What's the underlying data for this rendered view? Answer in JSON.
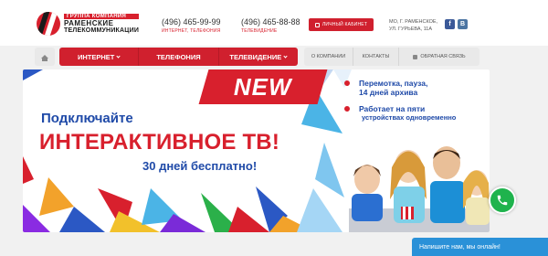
{
  "header": {
    "logo": {
      "group_label": "ГРУППА КОМПАНИЯ",
      "name_line1": "РАМЕНСКИЕ",
      "name_line2": "ТЕЛЕКОММУНИКАЦИИ"
    },
    "phones": [
      {
        "number": "(496) 465-99-99",
        "caption": "ИНТЕРНЕТ, ТЕЛЕФОНИЯ"
      },
      {
        "number": "(496) 465-88-88",
        "caption": "ТЕЛЕВИДЕНИЕ"
      }
    ],
    "cabinet_button": "ЛИЧНЫЙ КАБИНЕТ",
    "address_line1": "МО, Г. РАМЕНСКОЕ,",
    "address_line2": "УЛ. ГУРЬЕВА, 11А",
    "social": {
      "fb": "f",
      "vk": "B"
    }
  },
  "nav": {
    "main": [
      {
        "label": "ИНТЕРНЕТ",
        "dropdown": true
      },
      {
        "label": "ТЕЛЕФОНИЯ",
        "dropdown": false
      },
      {
        "label": "ТЕЛЕВИДЕНИЕ",
        "dropdown": true
      }
    ],
    "secondary": [
      {
        "label": "О КОМПАНИИ"
      },
      {
        "label": "КОНТАКТЫ"
      },
      {
        "label": "ОБРАТНАЯ СВЯЗЬ"
      }
    ]
  },
  "banner": {
    "badge": "NEW",
    "headline_top": "Подключайте",
    "headline_main": "ИНТЕРАКТИВНОЕ ТВ!",
    "headline_sub": "30 дней бесплатно!",
    "features": [
      {
        "line1": "Перемотка, пауза,",
        "line2": "14 дней архива"
      },
      {
        "line1": "Работает на пяти",
        "line2": "устройствах одновременно"
      }
    ]
  },
  "chat": {
    "label": "Напишите нам, мы онлайн!"
  },
  "colors": {
    "brand_red": "#d0202e",
    "brand_blue": "#1f4aa8",
    "chat_blue": "#2a91d8",
    "call_green": "#1fb34d"
  }
}
